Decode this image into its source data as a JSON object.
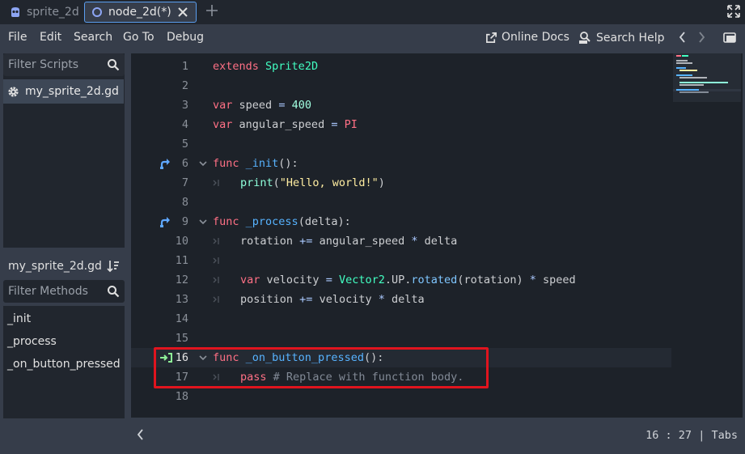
{
  "tabs": [
    {
      "label": "sprite_2d",
      "icon": "sprite-icon"
    },
    {
      "label": "node_2d(*)",
      "icon": "node2d-icon"
    }
  ],
  "menu": {
    "items": [
      "File",
      "Edit",
      "Search",
      "Go To",
      "Debug"
    ],
    "online_docs": "Online Docs",
    "search_help": "Search Help"
  },
  "scripts_panel": {
    "filter_placeholder": "Filter Scripts",
    "scripts": [
      "my_sprite_2d.gd"
    ]
  },
  "methods_panel": {
    "script_name": "my_sprite_2d.gd",
    "filter_placeholder": "Filter Methods",
    "methods": [
      "_init",
      "_process",
      "_on_button_pressed"
    ]
  },
  "editor": {
    "lines": [
      {
        "n": "1"
      },
      {
        "n": "2"
      },
      {
        "n": "3"
      },
      {
        "n": "4"
      },
      {
        "n": "5"
      },
      {
        "n": "6"
      },
      {
        "n": "7"
      },
      {
        "n": "8"
      },
      {
        "n": "9"
      },
      {
        "n": "10"
      },
      {
        "n": "11"
      },
      {
        "n": "12"
      },
      {
        "n": "13"
      },
      {
        "n": "14"
      },
      {
        "n": "15"
      },
      {
        "n": "16"
      },
      {
        "n": "17"
      },
      {
        "n": "18"
      }
    ],
    "code": {
      "l1a": "extends",
      "l1b": "Sprite2D",
      "l3a": "var",
      "l3b": "speed",
      "l3c": "=",
      "l3d": "400",
      "l4a": "var",
      "l4b": "angular_speed",
      "l4c": "=",
      "l4d": "PI",
      "l6a": "func",
      "l6b": "_init",
      "l6c": "():",
      "l7a": "print",
      "l7b": "(",
      "l7c": "\"Hello, world!\"",
      "l7d": ")",
      "l9a": "func",
      "l9b": "_process",
      "l9c": "(delta):",
      "l10a": "rotation",
      "l10b": "+=",
      "l10c": "angular_speed",
      "l10d": "*",
      "l10e": "delta",
      "l12a": "var",
      "l12b": "velocity",
      "l12c": "=",
      "l12d": "Vector2",
      "l12e": ".UP.",
      "l12f": "rotated",
      "l12g": "(rotation)",
      "l12h": "*",
      "l12i": "speed",
      "l13a": "position",
      "l13b": "+=",
      "l13c": "velocity",
      "l13d": "*",
      "l13e": "delta",
      "l16a": "func",
      "l16b": "_on_button_pressed",
      "l16c": "():",
      "l17a": "pass",
      "l17b": "# Replace with function body."
    }
  },
  "status": {
    "line": "16",
    "sep": ":",
    "col": "27",
    "pipe": "|",
    "indent": "Tabs"
  }
}
